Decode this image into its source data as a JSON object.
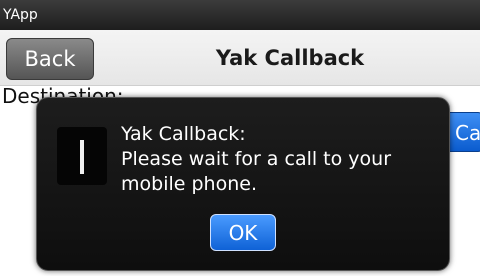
{
  "app": {
    "title": "YApp"
  },
  "header": {
    "back_label": "Back",
    "title": "Yak Callback"
  },
  "form": {
    "destination_label": "Destination:",
    "action_button_label": "Call"
  },
  "dialog": {
    "title": "Yak Callback:",
    "message_line1": "Please wait for a call to your",
    "message_line2": "mobile phone.",
    "ok_label": "OK",
    "icon": "info-icon"
  },
  "colors": {
    "accent": "#1a6fe0",
    "dialog_bg": "#141414"
  }
}
